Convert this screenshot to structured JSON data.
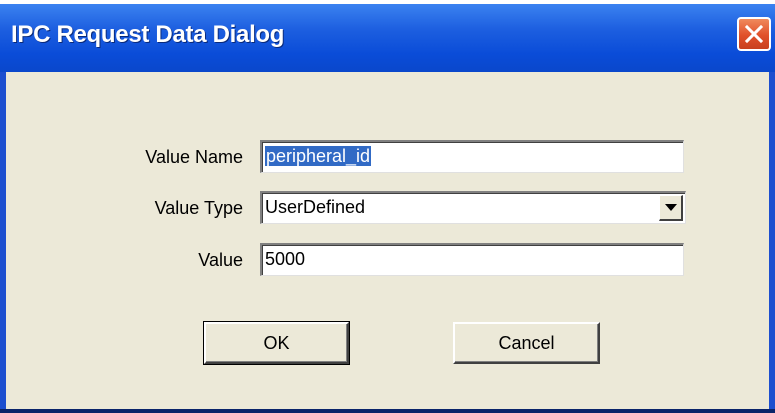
{
  "window": {
    "title": "IPC Request Data Dialog",
    "close_icon": "close-icon"
  },
  "form": {
    "value_name_label": "Value Name",
    "value_name": "peripheral_id",
    "value_type_label": "Value Type",
    "value_type": "UserDefined",
    "value_label": "Value",
    "value": "5000"
  },
  "buttons": {
    "ok_label": "OK",
    "cancel_label": "Cancel"
  },
  "colors": {
    "titlebar": "#0a4cd8",
    "client_background": "#ece9d8",
    "selection": "#316ac5",
    "close_button": "#e0502a"
  }
}
